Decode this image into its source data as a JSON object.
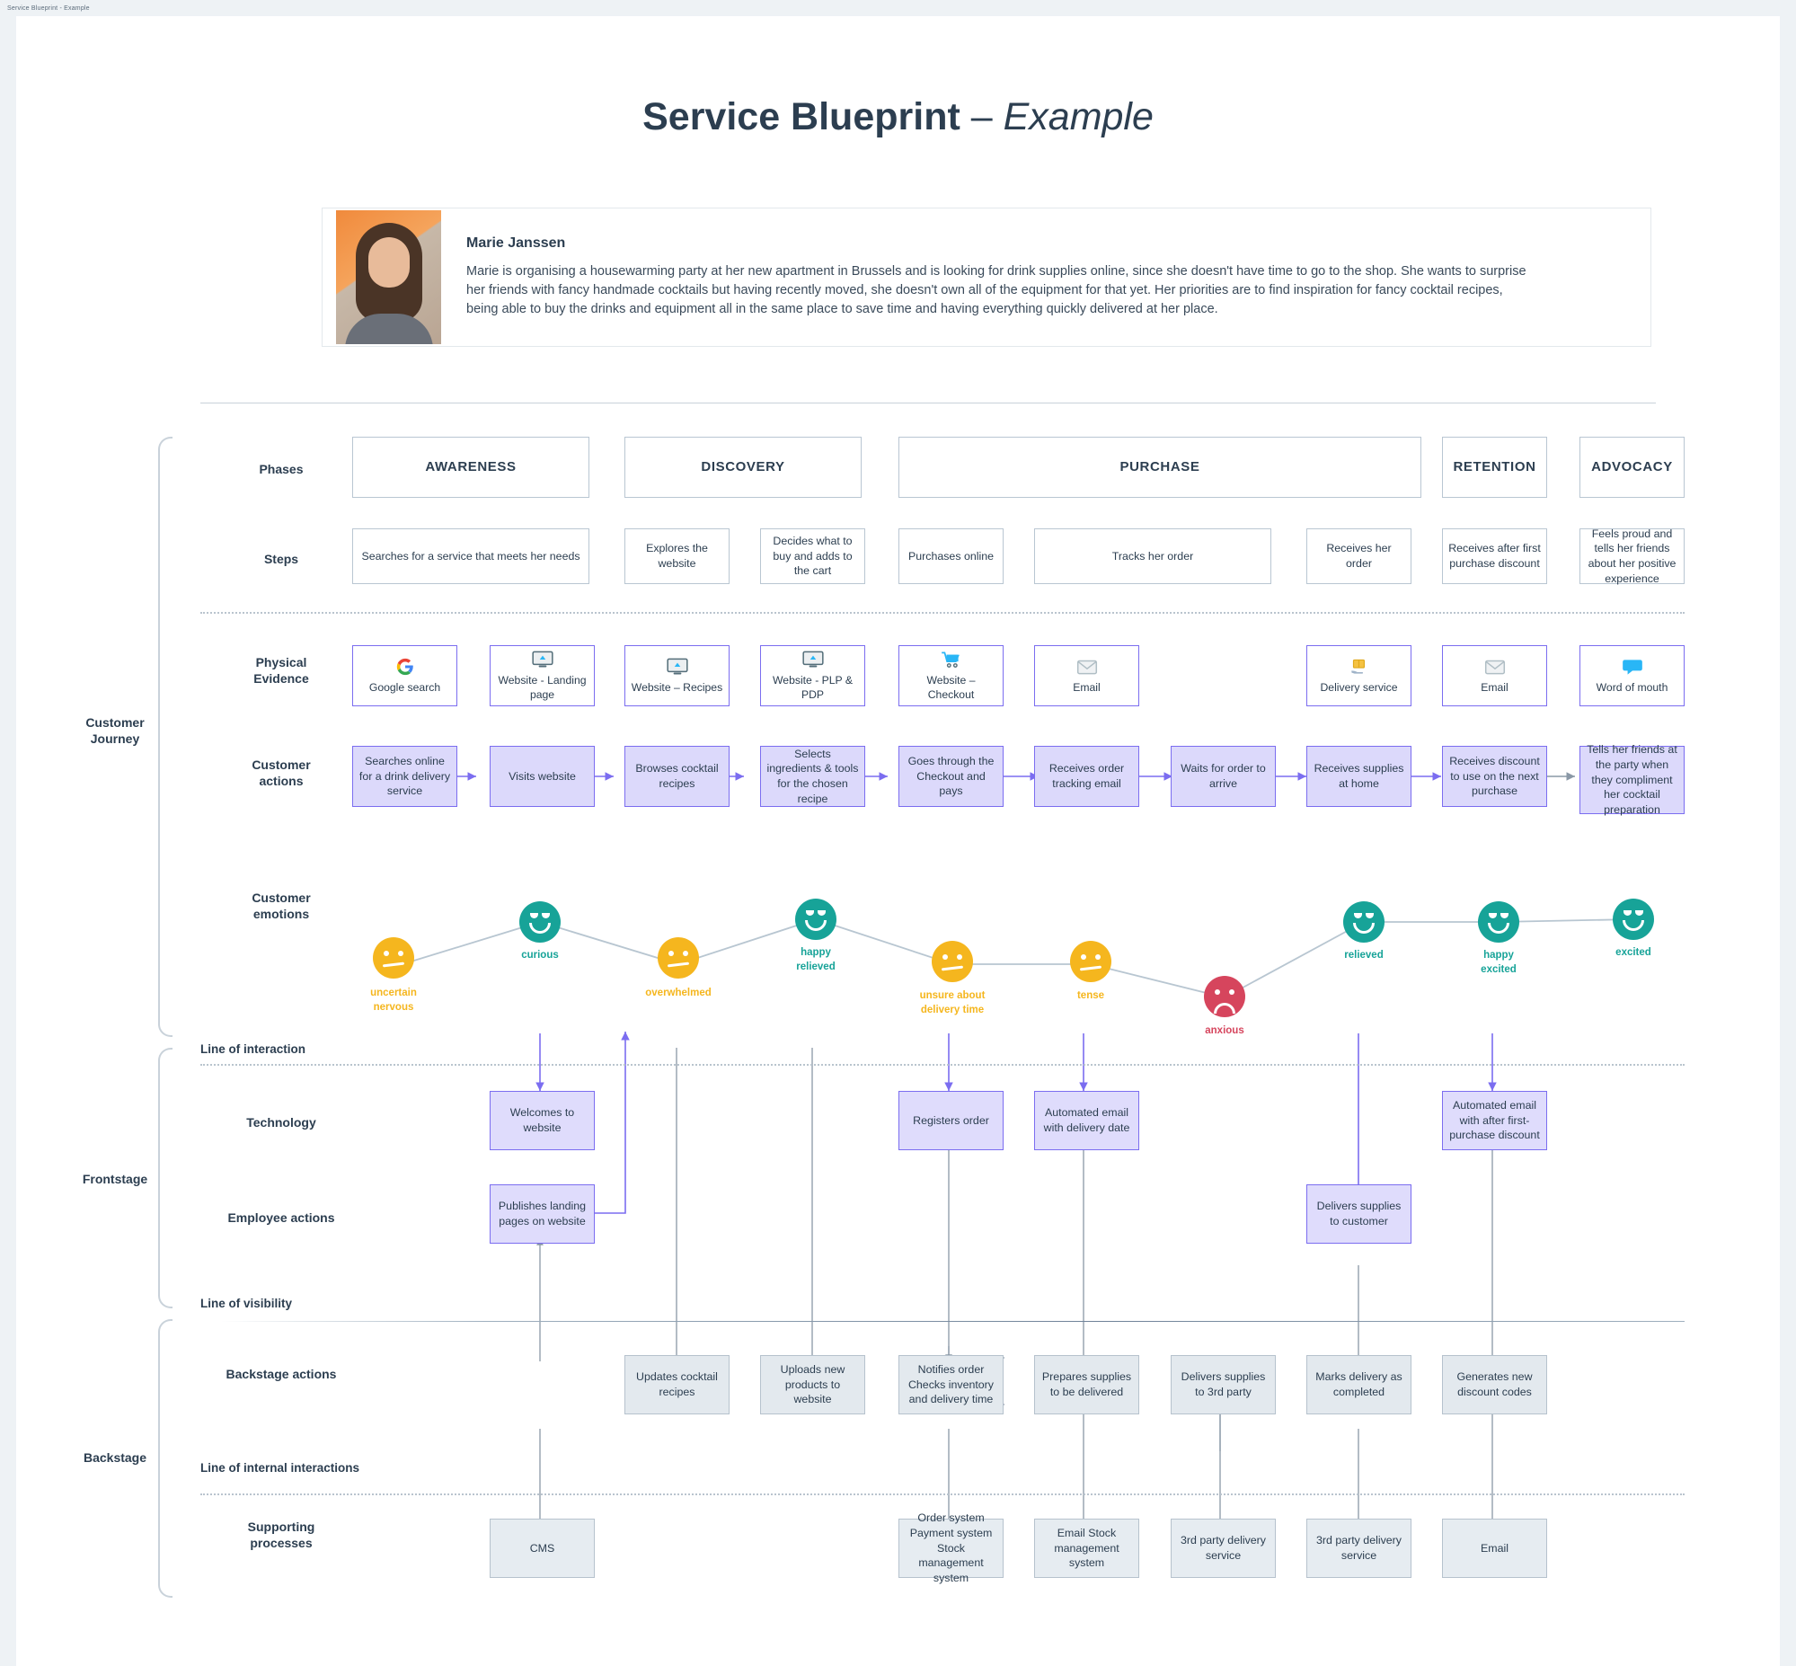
{
  "browser_tab_text": "Service Blueprint - Example",
  "header": {
    "title_main": "Service Blueprint",
    "title_dash": " – ",
    "title_italic": "Example"
  },
  "persona": {
    "name": "Marie Janssen",
    "description": "Marie is organising a housewarming party at her new apartment in Brussels and is looking for drink supplies online, since she doesn't have time to go to the shop. She wants to surprise her friends with fancy handmade cocktails but having recently moved, she doesn't own all of the equipment for that yet. Her priorities are to find inspiration for fancy cocktail recipes, being able to buy the drinks and equipment all in the same place to save time and having everything quickly delivered at her place.",
    "photo_alt": "persona-portrait"
  },
  "side_labels": {
    "customer_journey": "Customer\nJourney",
    "customer_journey_l1": "Customer",
    "customer_journey_l2": "Journey",
    "frontstage": "Frontstage",
    "backstage": "Backstage"
  },
  "rows": {
    "phases": "Phases",
    "steps": "Steps",
    "physical_evidence_l1": "Physical",
    "physical_evidence_l2": "Evidence",
    "customer_actions_l1": "Customer",
    "customer_actions_l2": "actions",
    "customer_emotions_l1": "Customer",
    "customer_emotions_l2": "emotions",
    "technology": "Technology",
    "employee_actions": "Employee actions",
    "backstage_actions": "Backstage actions",
    "supporting_processes_l1": "Supporting",
    "supporting_processes_l2": "processes"
  },
  "lines": {
    "interaction": "Line of interaction",
    "visibility": "Line of visibility",
    "internal": "Line of internal interactions"
  },
  "phases": [
    {
      "label": "AWARENESS"
    },
    {
      "label": "DISCOVERY"
    },
    {
      "label": "PURCHASE"
    },
    {
      "label": "RETENTION"
    },
    {
      "label": "ADVOCACY"
    }
  ],
  "steps": [
    {
      "label": "Searches for a service that meets her needs"
    },
    {
      "label": "Explores the website"
    },
    {
      "label": "Decides what to buy and adds to the cart"
    },
    {
      "label": "Purchases online"
    },
    {
      "label": "Tracks her order"
    },
    {
      "label": "Receives her order"
    },
    {
      "label": "Receives after first purchase discount"
    },
    {
      "label": "Feels proud and tells her friends about her positive experience"
    }
  ],
  "physical_evidence": [
    {
      "label": "Google search",
      "icon": "google-icon"
    },
    {
      "label": "Website - Landing page",
      "icon": "monitor-icon"
    },
    {
      "label": "Website – Recipes",
      "icon": "monitor-icon"
    },
    {
      "label": "Website - PLP & PDP",
      "icon": "monitor-icon"
    },
    {
      "label": "Website – Checkout",
      "icon": "shopping-cart-icon"
    },
    {
      "label": "Email",
      "icon": "envelope-icon"
    },
    {
      "label": "Delivery service",
      "icon": "package-hand-icon"
    },
    {
      "label": "Email",
      "icon": "envelope-icon"
    },
    {
      "label": "Word of mouth",
      "icon": "speech-bubble-icon"
    }
  ],
  "customer_actions": [
    {
      "label": "Searches online for a drink delivery service"
    },
    {
      "label": "Visits website"
    },
    {
      "label": "Browses cocktail recipes"
    },
    {
      "label": "Selects ingredients & tools for the chosen recipe"
    },
    {
      "label": "Goes through the Checkout and pays"
    },
    {
      "label": "Receives order tracking email"
    },
    {
      "label": "Waits for order to arrive"
    },
    {
      "label": "Receives supplies at home"
    },
    {
      "label": "Receives discount to use on the next purchase"
    },
    {
      "label": "Tells her friends at the party when they compliment her cocktail preparation"
    }
  ],
  "customer_emotions": [
    {
      "label": "uncertain\nnervous",
      "label_l1": "uncertain",
      "label_l2": "nervous",
      "mood": "neutral",
      "color": "#f5b61e"
    },
    {
      "label": "curious",
      "label_l1": "curious",
      "label_l2": "",
      "mood": "happy",
      "color": "#17a398"
    },
    {
      "label": "overwhelmed",
      "label_l1": "overwhelmed",
      "label_l2": "",
      "mood": "neutral",
      "color": "#f5b61e"
    },
    {
      "label": "happy\nrelieved",
      "label_l1": "happy",
      "label_l2": "relieved",
      "mood": "happy",
      "color": "#17a398"
    },
    {
      "label": "unsure about\ndelivery time",
      "label_l1": "unsure about",
      "label_l2": "delivery time",
      "mood": "neutral",
      "color": "#f5b61e"
    },
    {
      "label": "tense",
      "label_l1": "tense",
      "label_l2": "",
      "mood": "neutral",
      "color": "#f5b61e"
    },
    {
      "label": "anxious",
      "label_l1": "anxious",
      "label_l2": "",
      "mood": "sad",
      "color": "#d6455d"
    },
    {
      "label": "relieved",
      "label_l1": "relieved",
      "label_l2": "",
      "mood": "happy",
      "color": "#17a398"
    },
    {
      "label": "happy\nexcited",
      "label_l1": "happy",
      "label_l2": "excited",
      "mood": "happy",
      "color": "#17a398"
    },
    {
      "label": "excited",
      "label_l1": "excited",
      "label_l2": "",
      "mood": "happy",
      "color": "#17a398"
    }
  ],
  "technology": [
    {
      "label": "Welcomes to website"
    },
    {
      "label": "Registers order"
    },
    {
      "label": "Automated email with delivery date"
    },
    {
      "label": "Automated email with after first-purchase discount"
    }
  ],
  "employee_actions": [
    {
      "label": "Publishes landing pages on website"
    },
    {
      "label": "Delivers supplies to customer"
    }
  ],
  "backstage_actions": [
    {
      "label": "Updates cocktail recipes"
    },
    {
      "label": "Uploads new products to website"
    },
    {
      "label": "Notifies order Checks inventory and delivery time"
    },
    {
      "label": "Prepares supplies to be delivered"
    },
    {
      "label": "Delivers supplies to 3rd party"
    },
    {
      "label": "Marks delivery as completed"
    },
    {
      "label": "Generates new discount codes"
    }
  ],
  "supporting_processes": [
    {
      "label": "CMS"
    },
    {
      "label": "Order system Payment system Stock management system"
    },
    {
      "label": "Email Stock management system"
    },
    {
      "label": "3rd party delivery service"
    },
    {
      "label": "3rd party delivery service"
    },
    {
      "label": "Email"
    }
  ],
  "colors": {
    "accent_purple": "#7b6df0",
    "purple_fill": "#dcd9fb",
    "grey_fill": "#e3e9ee",
    "teal": "#17a398",
    "yellow": "#f5b61e",
    "red": "#d6455d",
    "ink": "#2c3e50"
  }
}
